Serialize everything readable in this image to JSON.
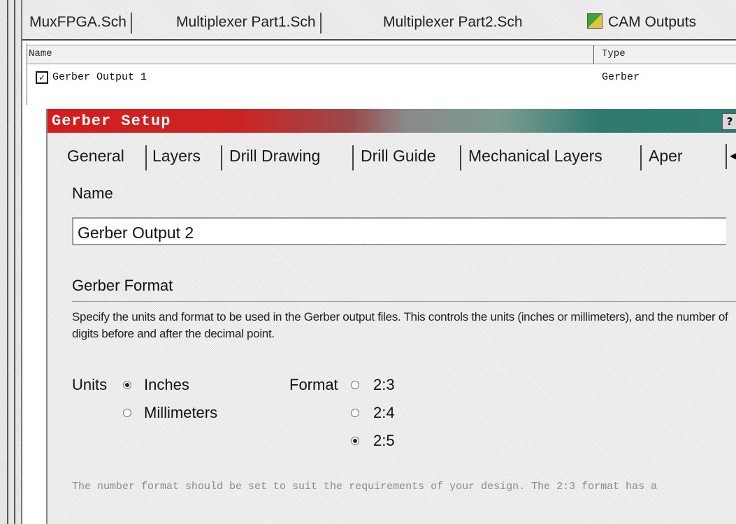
{
  "doc_tabs": {
    "items": [
      {
        "label": "MuxFPGA.Sch"
      },
      {
        "label": "Multiplexer Part1.Sch"
      },
      {
        "label": "Multiplexer Part2.Sch"
      },
      {
        "label": "CAM Outputs",
        "icon": "cam-outputs-icon"
      }
    ]
  },
  "list": {
    "columns": {
      "name": "Name",
      "type": "Type"
    },
    "rows": [
      {
        "checked": true,
        "check_glyph": "✓",
        "name": "Gerber Output 1",
        "type": "Gerber"
      }
    ]
  },
  "dialog": {
    "title": "Gerber Setup",
    "help": "?",
    "tabs": [
      {
        "label": "General",
        "active": true
      },
      {
        "label": "Layers"
      },
      {
        "label": "Drill Drawing"
      },
      {
        "label": "Drill Guide"
      },
      {
        "label": "Mechanical Layers"
      },
      {
        "label": "Aper"
      }
    ],
    "tab_scroll_icon": "◄",
    "name_label": "Name",
    "name_value": "Gerber Output 2",
    "section_title": "Gerber Format",
    "description": "Specify the units and format to be used in the Gerber output files. This controls the units (inches or millimeters), and the number of digits before and after the decimal point.",
    "units_label": "Units",
    "units_options": [
      {
        "label": "Inches",
        "selected": true
      },
      {
        "label": "Millimeters",
        "selected": false
      }
    ],
    "format_label": "Format",
    "format_options": [
      {
        "label": "2:3",
        "selected": false
      },
      {
        "label": "2:4",
        "selected": false
      },
      {
        "label": "2:5",
        "selected": true
      }
    ],
    "note": "The number format should be set to suit the requirements of your design. The 2:3 format has a"
  }
}
